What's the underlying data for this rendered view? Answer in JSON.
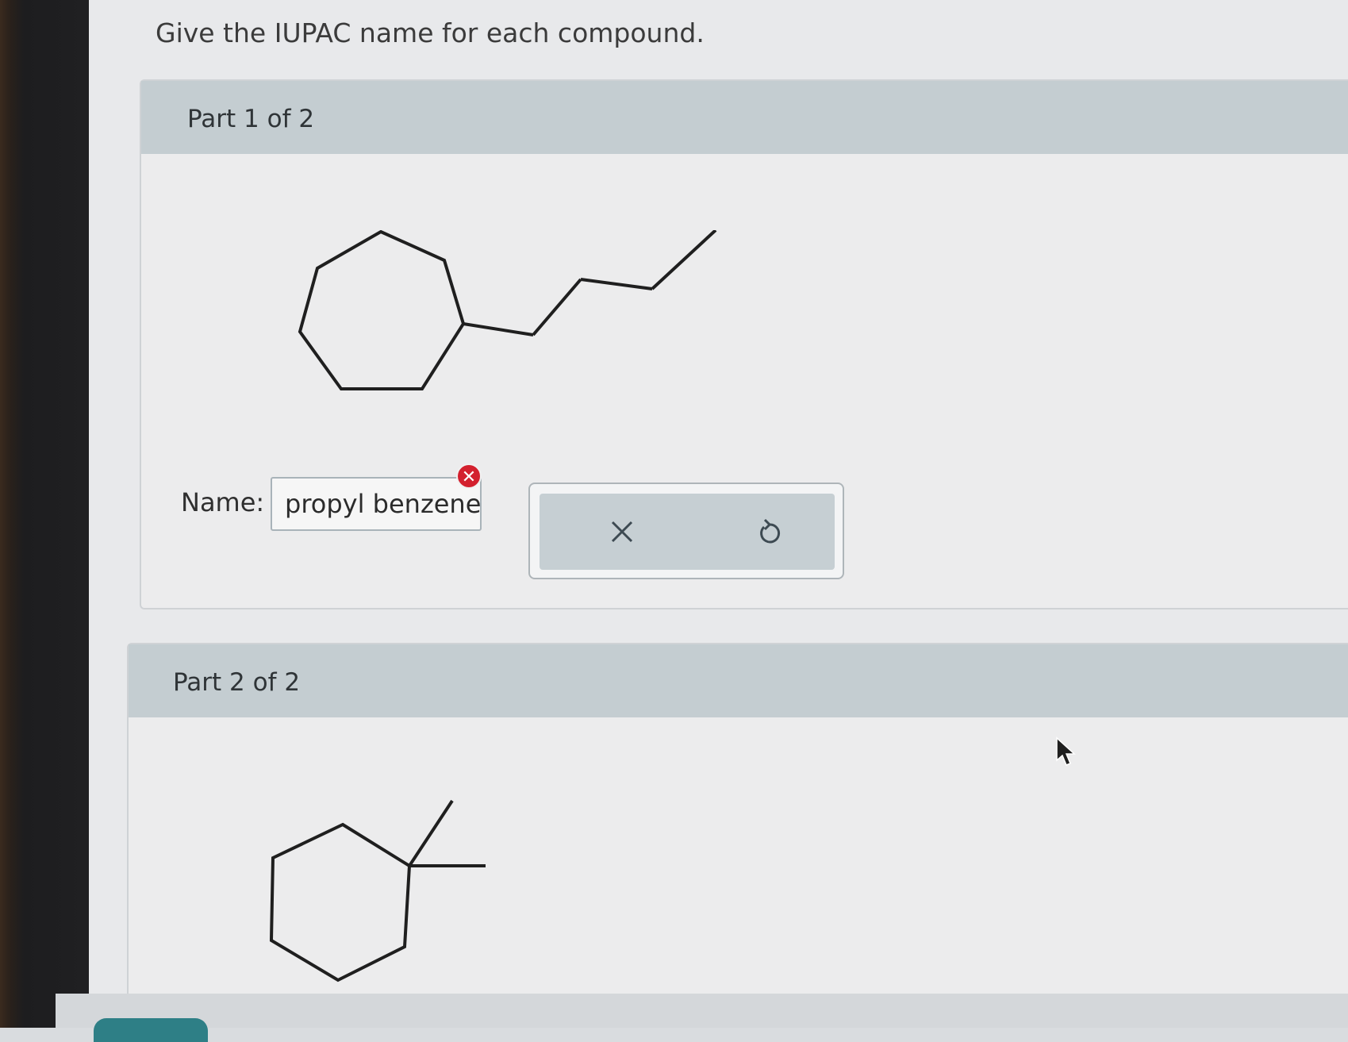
{
  "question": {
    "instruction": "Give the IUPAC name for each compound."
  },
  "part1": {
    "header": "Part 1 of 2",
    "molecule_icon": "cycloheptane-butyl-structure",
    "name_label": "Name:",
    "answer_value": "propyl benzene",
    "answer_status": "incorrect",
    "error_icon": "x-circle-icon",
    "error_color": "#d3202e",
    "tools": {
      "clear_icon": "close-icon",
      "undo_icon": "undo-icon"
    }
  },
  "part2": {
    "header": "Part 2 of 2",
    "molecule_icon": "cyclohexane-dimethyl-structure"
  },
  "colors": {
    "header_bg": "#c4cdd1",
    "card_bg": "#ececed",
    "accent": "#2e7f86"
  }
}
